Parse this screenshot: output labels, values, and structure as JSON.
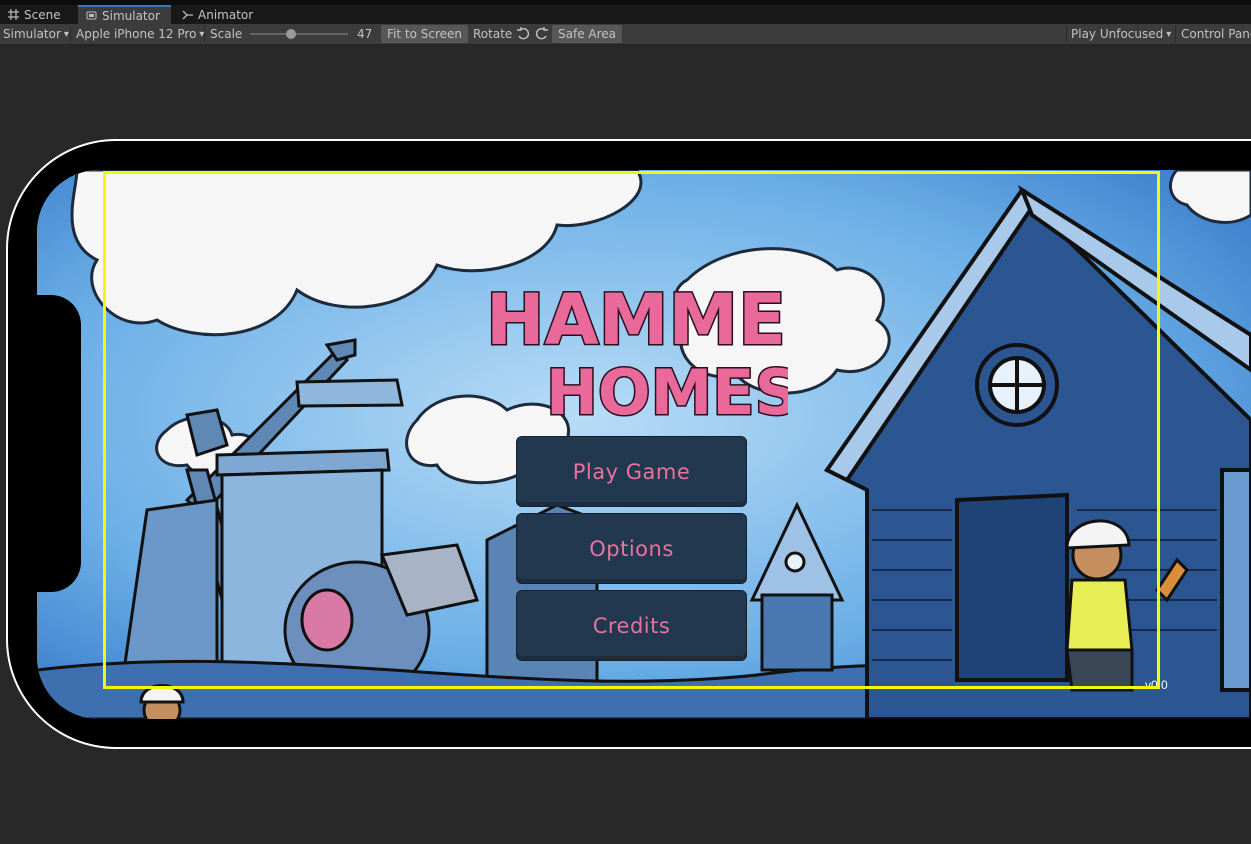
{
  "tabs": [
    {
      "label": "Scene",
      "icon": "grid-icon"
    },
    {
      "label": "Simulator",
      "icon": "device-icon",
      "active": true
    },
    {
      "label": "Animator",
      "icon": "animator-icon"
    }
  ],
  "toolbar": {
    "mode_dropdown": "Simulator",
    "device_dropdown": "Apple iPhone 12 Pro",
    "scale_label": "Scale",
    "scale_value": "47",
    "fit_to_screen": "Fit to Screen",
    "rotate_label": "Rotate",
    "safe_area": "Safe Area",
    "play_mode": "Play Unfocused",
    "control_panel": "Control Pane"
  },
  "game": {
    "logo_line1": "HAMMER",
    "logo_line2": "HOMES",
    "menu": [
      {
        "label": "Play Game"
      },
      {
        "label": "Options"
      },
      {
        "label": "Credits"
      }
    ],
    "version": "v0.0",
    "colors": {
      "button_bg": "#22384f",
      "button_text": "#e9729f",
      "safe_area": "#f3f70b",
      "logo_pink": "#e96a9a"
    }
  }
}
